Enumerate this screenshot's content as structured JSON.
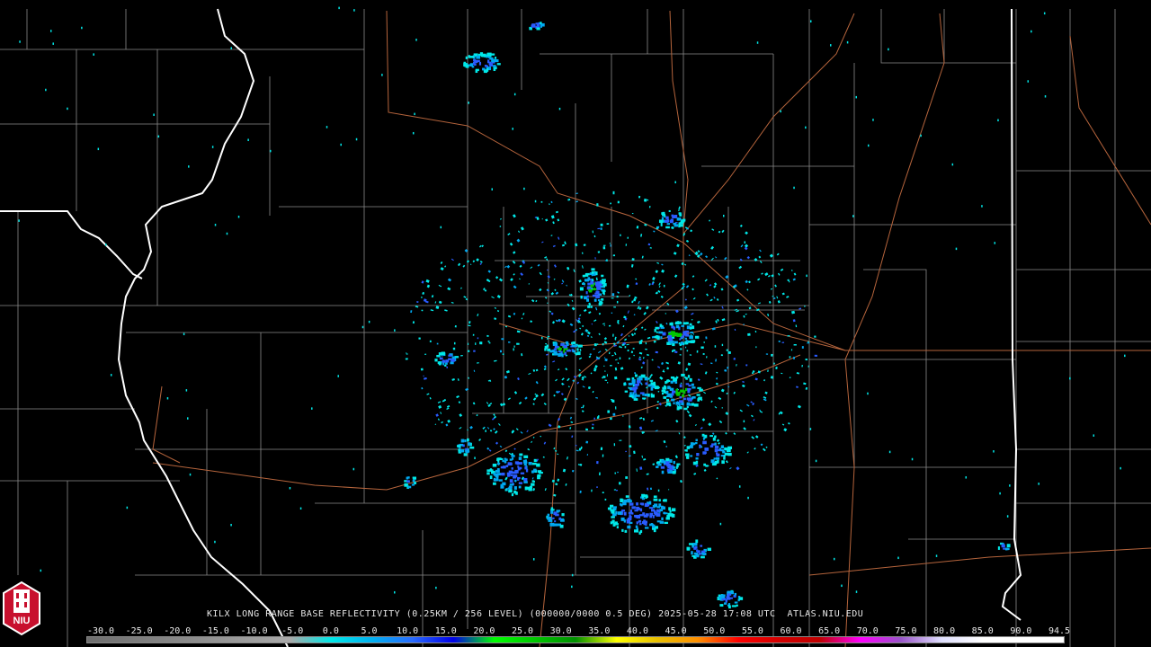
{
  "product_title": "KILX LONG RANGE BASE REFLECTIVITY (0.25KM / 256 LEVEL) (000000/0000 0.5 DEG) 2025-05-28 17:08 UTC  ATLAS.NIU.EDU",
  "logo_text": "NIU",
  "scale": {
    "labels": [
      "-30.0",
      "-25.0",
      "-20.0",
      "-15.0",
      "-10.0",
      "-5.0",
      "0.0",
      "5.0",
      "10.0",
      "15.0",
      "20.0",
      "25.0",
      "30.0",
      "35.0",
      "40.0",
      "45.0",
      "50.0",
      "55.0",
      "60.0",
      "65.0",
      "70.0",
      "75.0",
      "80.0",
      "85.0",
      "90.0",
      "94.5"
    ],
    "colors": [
      "#6e6e6e",
      "#7a7a7a",
      "#868686",
      "#929292",
      "#9e9e9e",
      "#aaaaaa",
      "#00e8e8",
      "#00b0f0",
      "#2a6cff",
      "#0000e8",
      "#00ff00",
      "#00c800",
      "#009000",
      "#ffff00",
      "#e8c000",
      "#ff9000",
      "#ff0000",
      "#d40000",
      "#c00000",
      "#ff00ff",
      "#9955c9",
      "#e0e0ff",
      "#ffffff",
      "#ffffff",
      "#ffffff"
    ]
  },
  "colors": {
    "background": "#000000",
    "county_lines": "#8a8a8a",
    "state_lines": "#ffffff",
    "roads": "#b5643c",
    "echo_light": "#00e8e8",
    "echo_medium": "#00a8f0",
    "echo_heavy": "#2a5cff",
    "echo_core": "#00c800"
  }
}
